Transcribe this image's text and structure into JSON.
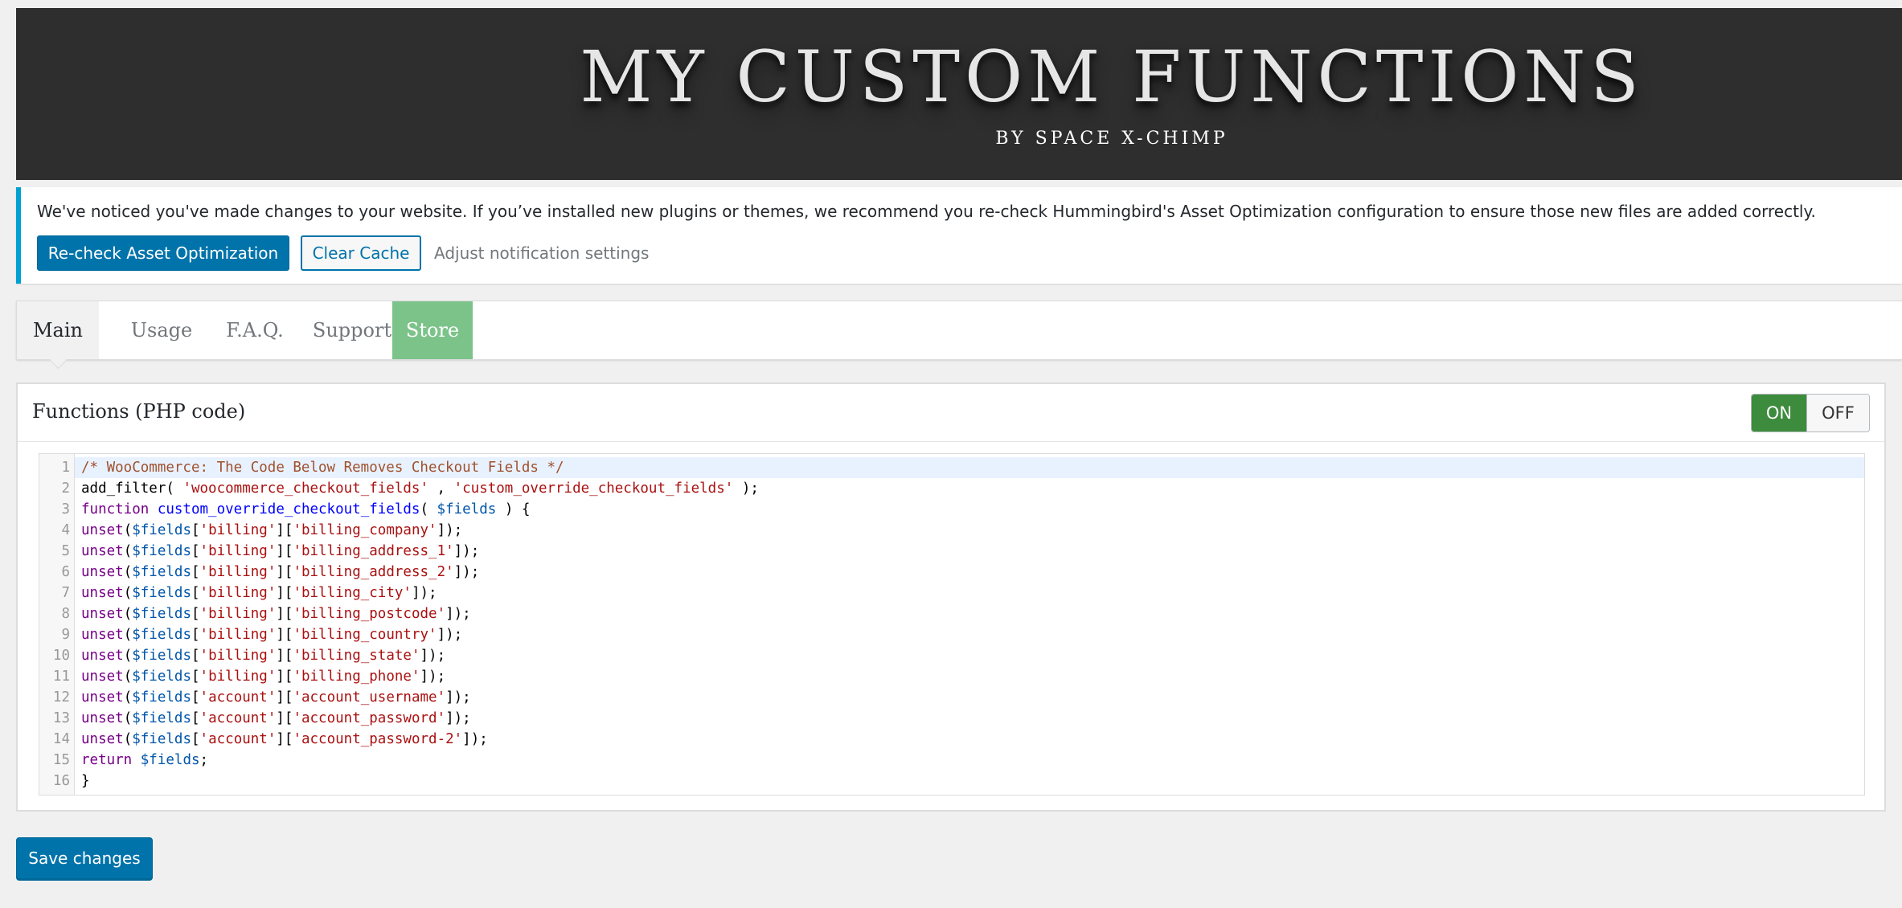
{
  "header": {
    "title": "MY CUSTOM FUNCTIONS",
    "subtitle": "BY SPACE X-CHIMP"
  },
  "notice": {
    "message": "We've noticed you've made changes to your website. If you’ve installed new plugins or themes, we recommend you re-check Hummingbird's Asset Optimization configuration to ensure those new files are added correctly.",
    "primary_button": "Re-check Asset Optimization",
    "secondary_button": "Clear Cache",
    "settings_link": "Adjust notification settings",
    "accent_color": "#00a0d2"
  },
  "tabs": [
    {
      "label": "Main",
      "active": true
    },
    {
      "label": "Usage",
      "active": false
    },
    {
      "label": "F.A.Q.",
      "active": false
    },
    {
      "label": "Support",
      "active": false
    },
    {
      "label": "Store",
      "active": false,
      "color": "#7cc38a"
    }
  ],
  "panel": {
    "title": "Functions (PHP code)",
    "toggle": {
      "on_label": "ON",
      "off_label": "OFF",
      "state": "on",
      "on_color": "#3d8b3d"
    }
  },
  "code": {
    "active_line": 1,
    "lines": [
      [
        [
          "comment",
          "/* WooCommerce: The Code Below Removes Checkout Fields */"
        ]
      ],
      [
        [
          "plain",
          "add_filter( "
        ],
        [
          "string",
          "'woocommerce_checkout_fields'"
        ],
        [
          "plain",
          " , "
        ],
        [
          "string",
          "'custom_override_checkout_fields'"
        ],
        [
          "plain",
          " );"
        ]
      ],
      [
        [
          "kw",
          "function "
        ],
        [
          "def",
          "custom_override_checkout_fields"
        ],
        [
          "plain",
          "( "
        ],
        [
          "var",
          "$fields"
        ],
        [
          "plain",
          " ) {"
        ]
      ],
      [
        [
          "kw",
          "unset"
        ],
        [
          "plain",
          "("
        ],
        [
          "var",
          "$fields"
        ],
        [
          "plain",
          "["
        ],
        [
          "string",
          "'billing'"
        ],
        [
          "plain",
          "]["
        ],
        [
          "string",
          "'billing_company'"
        ],
        [
          "plain",
          "]);"
        ]
      ],
      [
        [
          "kw",
          "unset"
        ],
        [
          "plain",
          "("
        ],
        [
          "var",
          "$fields"
        ],
        [
          "plain",
          "["
        ],
        [
          "string",
          "'billing'"
        ],
        [
          "plain",
          "]["
        ],
        [
          "string",
          "'billing_address_1'"
        ],
        [
          "plain",
          "]);"
        ]
      ],
      [
        [
          "kw",
          "unset"
        ],
        [
          "plain",
          "("
        ],
        [
          "var",
          "$fields"
        ],
        [
          "plain",
          "["
        ],
        [
          "string",
          "'billing'"
        ],
        [
          "plain",
          "]["
        ],
        [
          "string",
          "'billing_address_2'"
        ],
        [
          "plain",
          "]);"
        ]
      ],
      [
        [
          "kw",
          "unset"
        ],
        [
          "plain",
          "("
        ],
        [
          "var",
          "$fields"
        ],
        [
          "plain",
          "["
        ],
        [
          "string",
          "'billing'"
        ],
        [
          "plain",
          "]["
        ],
        [
          "string",
          "'billing_city'"
        ],
        [
          "plain",
          "]);"
        ]
      ],
      [
        [
          "kw",
          "unset"
        ],
        [
          "plain",
          "("
        ],
        [
          "var",
          "$fields"
        ],
        [
          "plain",
          "["
        ],
        [
          "string",
          "'billing'"
        ],
        [
          "plain",
          "]["
        ],
        [
          "string",
          "'billing_postcode'"
        ],
        [
          "plain",
          "]);"
        ]
      ],
      [
        [
          "kw",
          "unset"
        ],
        [
          "plain",
          "("
        ],
        [
          "var",
          "$fields"
        ],
        [
          "plain",
          "["
        ],
        [
          "string",
          "'billing'"
        ],
        [
          "plain",
          "]["
        ],
        [
          "string",
          "'billing_country'"
        ],
        [
          "plain",
          "]);"
        ]
      ],
      [
        [
          "kw",
          "unset"
        ],
        [
          "plain",
          "("
        ],
        [
          "var",
          "$fields"
        ],
        [
          "plain",
          "["
        ],
        [
          "string",
          "'billing'"
        ],
        [
          "plain",
          "]["
        ],
        [
          "string",
          "'billing_state'"
        ],
        [
          "plain",
          "]);"
        ]
      ],
      [
        [
          "kw",
          "unset"
        ],
        [
          "plain",
          "("
        ],
        [
          "var",
          "$fields"
        ],
        [
          "plain",
          "["
        ],
        [
          "string",
          "'billing'"
        ],
        [
          "plain",
          "]["
        ],
        [
          "string",
          "'billing_phone'"
        ],
        [
          "plain",
          "]);"
        ]
      ],
      [
        [
          "kw",
          "unset"
        ],
        [
          "plain",
          "("
        ],
        [
          "var",
          "$fields"
        ],
        [
          "plain",
          "["
        ],
        [
          "string",
          "'account'"
        ],
        [
          "plain",
          "]["
        ],
        [
          "string",
          "'account_username'"
        ],
        [
          "plain",
          "]);"
        ]
      ],
      [
        [
          "kw",
          "unset"
        ],
        [
          "plain",
          "("
        ],
        [
          "var",
          "$fields"
        ],
        [
          "plain",
          "["
        ],
        [
          "string",
          "'account'"
        ],
        [
          "plain",
          "]["
        ],
        [
          "string",
          "'account_password'"
        ],
        [
          "plain",
          "]);"
        ]
      ],
      [
        [
          "kw",
          "unset"
        ],
        [
          "plain",
          "("
        ],
        [
          "var",
          "$fields"
        ],
        [
          "plain",
          "["
        ],
        [
          "string",
          "'account'"
        ],
        [
          "plain",
          "]["
        ],
        [
          "string",
          "'account_password-2'"
        ],
        [
          "plain",
          "]);"
        ]
      ],
      [
        [
          "kw",
          "return "
        ],
        [
          "var",
          "$fields"
        ],
        [
          "plain",
          ";"
        ]
      ],
      [
        [
          "plain",
          "}"
        ]
      ]
    ]
  },
  "footer": {
    "save_label": "Save changes"
  }
}
